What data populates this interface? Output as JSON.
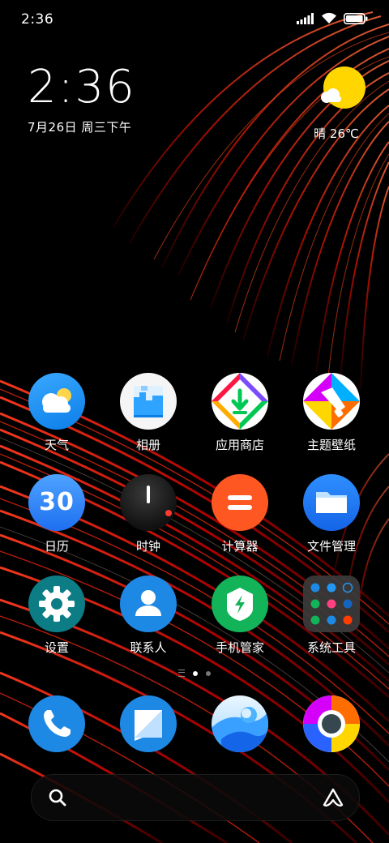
{
  "status_bar": {
    "time": "2:36",
    "icons": [
      "signal-icon",
      "wifi-icon",
      "battery-icon"
    ]
  },
  "clock_widget": {
    "time": "2:36",
    "date": "7月26日 周三下午"
  },
  "weather_widget": {
    "icon": "sun-cloud-icon",
    "text": "晴 26℃"
  },
  "apps": [
    {
      "id": "weather",
      "label": "天气",
      "icon": "weather-icon"
    },
    {
      "id": "gallery",
      "label": "相册",
      "icon": "gallery-icon"
    },
    {
      "id": "appstore",
      "label": "应用商店",
      "icon": "app-store-icon"
    },
    {
      "id": "themes",
      "label": "主题壁纸",
      "icon": "themes-icon"
    },
    {
      "id": "calendar",
      "label": "日历",
      "icon": "calendar-icon",
      "icon_text": "30"
    },
    {
      "id": "clock",
      "label": "时钟",
      "icon": "clock-icon"
    },
    {
      "id": "calculator",
      "label": "计算器",
      "icon": "calculator-icon"
    },
    {
      "id": "files",
      "label": "文件管理",
      "icon": "file-manager-icon"
    },
    {
      "id": "settings",
      "label": "设置",
      "icon": "settings-icon"
    },
    {
      "id": "contacts",
      "label": "联系人",
      "icon": "contacts-icon"
    },
    {
      "id": "security",
      "label": "手机管家",
      "icon": "security-icon"
    },
    {
      "id": "tools",
      "label": "系统工具",
      "icon": "system-tools-folder-icon"
    }
  ],
  "page_indicator": {
    "pages": 2,
    "current": 1
  },
  "dock": [
    {
      "id": "phone",
      "icon": "phone-icon"
    },
    {
      "id": "messages",
      "icon": "messages-icon"
    },
    {
      "id": "browser",
      "icon": "browser-icon"
    },
    {
      "id": "chrome",
      "icon": "chrome-icon"
    }
  ],
  "search_bar": {
    "left_icon": "search-icon",
    "right_icon": "assistant-icon"
  },
  "colors": {
    "accent_blue": "#1e88e5",
    "calc_orange": "#ff5722",
    "security_green": "#13b35a",
    "weather_yellow": "#ffd600"
  }
}
